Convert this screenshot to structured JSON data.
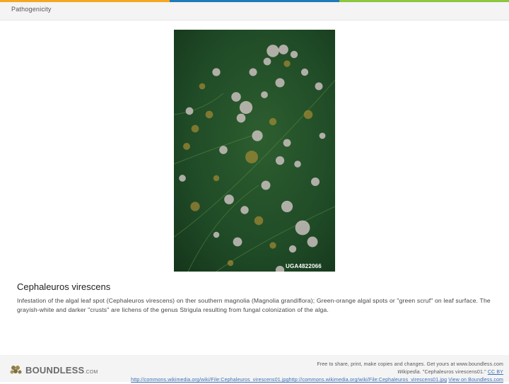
{
  "colors": {
    "accent_bar": [
      "#f5a623",
      "#1f7bb6",
      "#8dc63f"
    ],
    "leaf_green": "#1f4a26",
    "lichen_white": "#c9c0bd",
    "algal_orange": "#a58a34"
  },
  "header": {
    "title": "Pathogenicity"
  },
  "figure": {
    "badge": "UGA4822066",
    "title": "Cephaleuros virescens",
    "description": "Infestation of the algal leaf spot (Cephaleuros virescens) on ther southern magnolia (Magnolia grandiflora); Green-orange algal spots or \"green scruf\" on leaf surface. The grayish-white and darker \"crusts\" are lichens of the genus Strigula resulting from fungal colonization of the alga."
  },
  "footer": {
    "logo_icon": "boundless-grape-icon",
    "logo_text": "BOUNDLESS",
    "logo_suffix": ".COM",
    "line1": "Free to share, print, make copies and changes. Get yours at www.boundless.com",
    "line2_italic": "Wikipedia.",
    "line2_text": " \"Cephaleuros virescens01.\"",
    "line2_link": "CC BY",
    "line3_link": "http://commons.wikimedia.org/wiki/File:Cephaleuros_virescens01.jpghttp://commons.wikimedia.org/wiki/File:Cephaleuros_virescens01.jpg",
    "line3_view": "View on Boundless.com"
  }
}
